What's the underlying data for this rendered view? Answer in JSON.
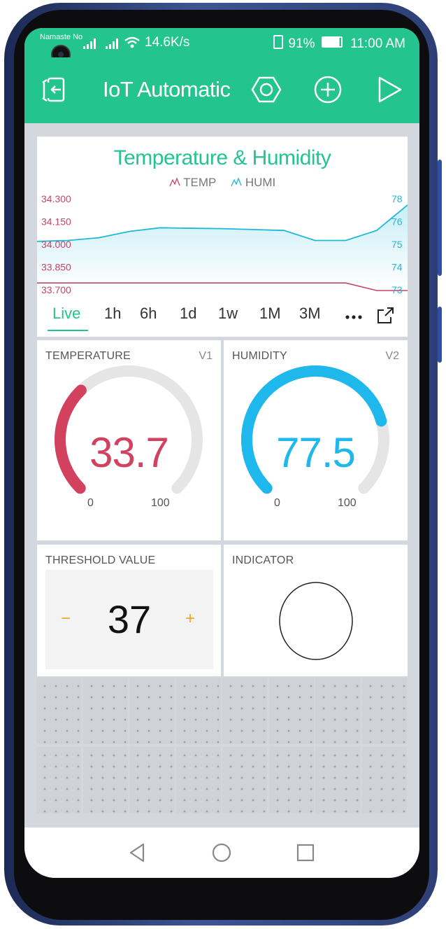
{
  "status_bar": {
    "carrier": "Namaste No",
    "network_speed": "14.6K/s",
    "battery": "91%",
    "time": "11:00 AM"
  },
  "app_bar": {
    "title": "IoT Automatic",
    "icons": [
      "exit-icon",
      "settings-hexagon-icon",
      "add-icon",
      "play-icon"
    ]
  },
  "chart": {
    "title": "Temperature & Humidity",
    "legend": [
      {
        "label": "TEMP",
        "color": "#c44569"
      },
      {
        "label": "HUMI",
        "color": "#1fb8d8"
      }
    ],
    "left_ticks": [
      "34.300",
      "34.150",
      "34.000",
      "33.850",
      "33.700"
    ],
    "right_ticks": [
      "78",
      "76",
      "75",
      "74",
      "73"
    ],
    "tabs": [
      "Live",
      "1h",
      "6h",
      "1d",
      "1w",
      "1M",
      "3M"
    ],
    "active_tab": "Live"
  },
  "chart_data": {
    "type": "line",
    "title": "Temperature & Humidity",
    "x": [
      0,
      1,
      2,
      3,
      4,
      5,
      6,
      7,
      8,
      9,
      10,
      11,
      12
    ],
    "series": [
      {
        "name": "TEMP",
        "axis": "left",
        "values": [
          33.75,
          33.75,
          33.75,
          33.75,
          33.75,
          33.75,
          33.75,
          33.75,
          33.75,
          33.75,
          33.75,
          33.7,
          33.7
        ],
        "color": "#c44569"
      },
      {
        "name": "HUMI",
        "axis": "right",
        "values": [
          75.7,
          75.75,
          75.9,
          76.25,
          76.45,
          76.42,
          76.4,
          76.35,
          76.3,
          75.75,
          75.75,
          76.3,
          77.7
        ],
        "color": "#1fb8d8"
      }
    ],
    "ylim_left": [
      33.7,
      34.3
    ],
    "ylim_right": [
      73,
      78
    ],
    "grid": false,
    "legend": "top-center"
  },
  "gauges": [
    {
      "label": "TEMPERATURE",
      "pin": "V1",
      "value": "33.7",
      "fraction": 0.337,
      "min": "0",
      "max": "100",
      "color": "#d2415e"
    },
    {
      "label": "HUMIDITY",
      "pin": "V2",
      "value": "77.5",
      "fraction": 0.775,
      "min": "0",
      "max": "100",
      "color": "#1fb8ec"
    }
  ],
  "threshold": {
    "label": "THRESHOLD VALUE",
    "value": "37",
    "minus": "−",
    "plus": "+"
  },
  "indicator": {
    "label": "INDICATOR"
  },
  "navigation": [
    "back-icon",
    "home-icon",
    "recents-icon"
  ]
}
